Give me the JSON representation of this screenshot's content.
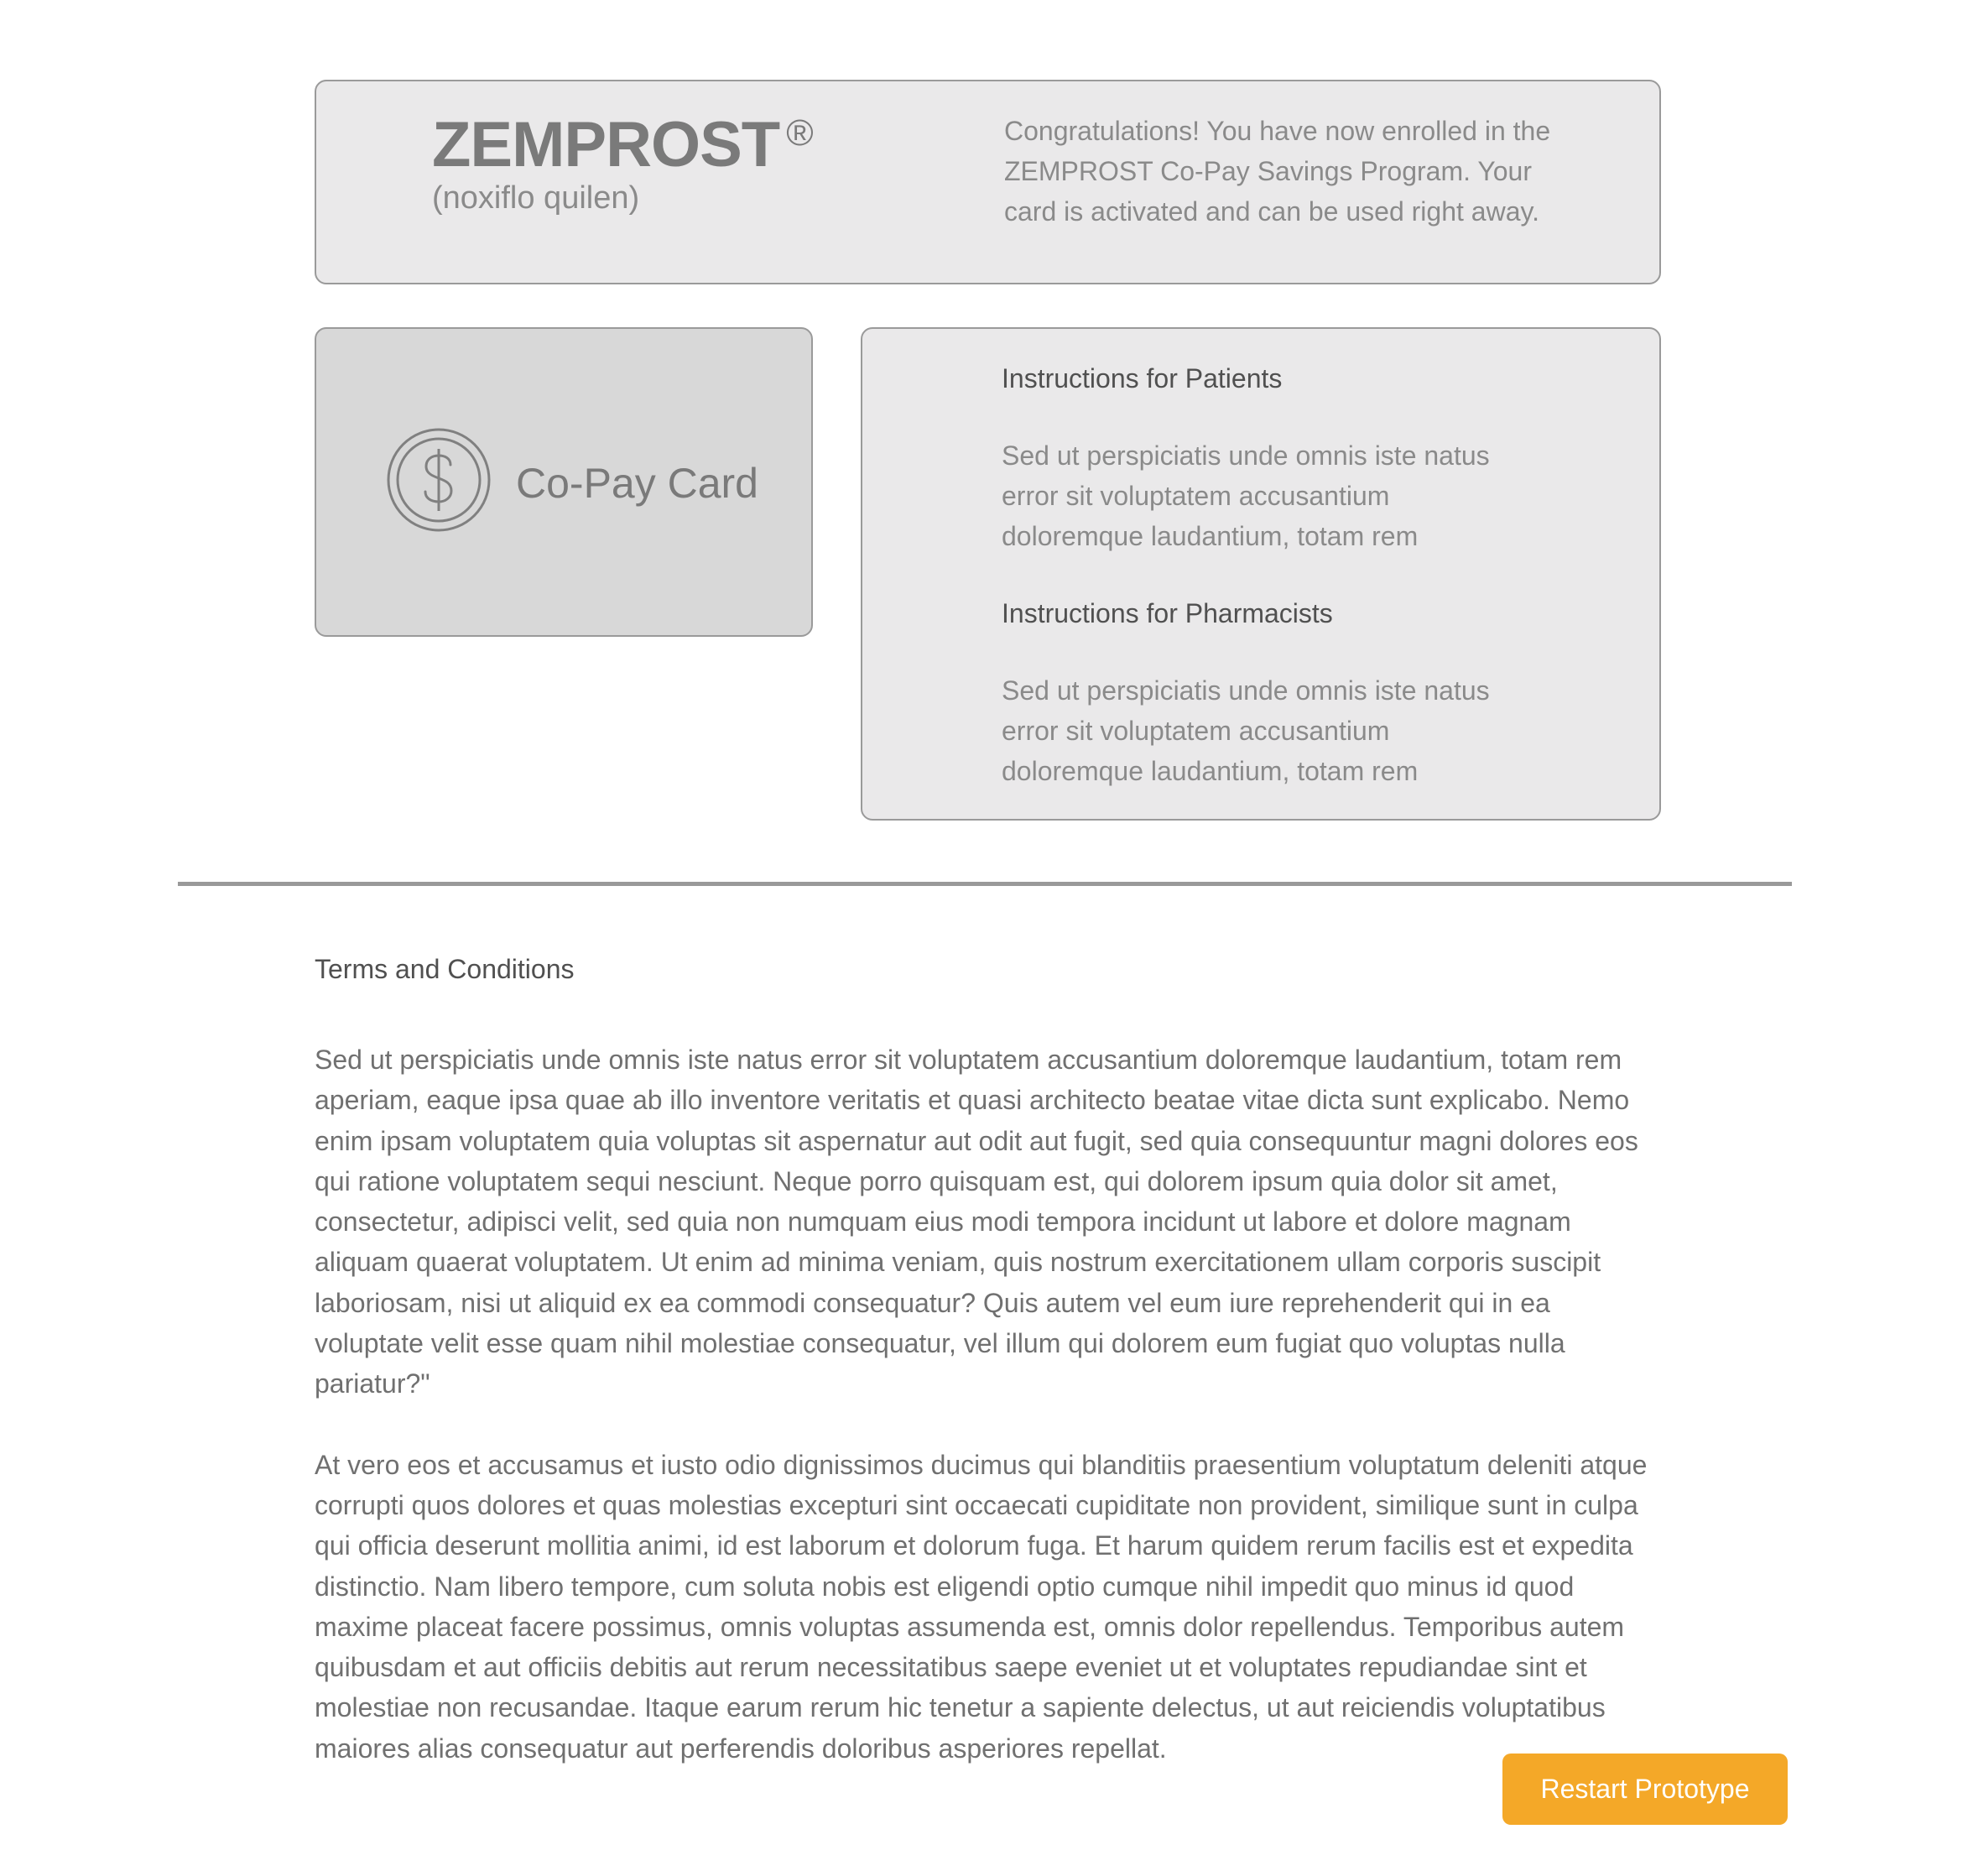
{
  "header": {
    "brand_name": "ZEMPROST",
    "brand_reg": "®",
    "brand_generic": "(noxiflo quilen)",
    "message": "Congratulations! You have now enrolled in the ZEMPROST Co-Pay Savings Program. Your card is activated and can be used right away."
  },
  "card": {
    "icon": "dollar-coin-icon",
    "label": "Co-Pay Card"
  },
  "instructions": {
    "patients_title": "Instructions for Patients",
    "patients_text": "Sed ut perspiciatis unde omnis iste natus error sit voluptatem accusantium doloremque laudantium, totam rem",
    "pharmacists_title": "Instructions for Pharmacists",
    "pharmacists_text": "Sed ut perspiciatis unde omnis iste natus error sit voluptatem accusantium doloremque laudantium, totam rem"
  },
  "terms": {
    "title": "Terms and Conditions",
    "paragraphs": [
      "Sed ut perspiciatis unde omnis iste natus error sit voluptatem accusantium doloremque laudantium, totam rem aperiam, eaque ipsa quae ab illo inventore veritatis et quasi architecto beatae vitae dicta sunt explicabo. Nemo enim ipsam voluptatem quia voluptas sit aspernatur aut odit aut fugit, sed quia consequuntur magni dolores eos qui ratione voluptatem sequi nesciunt. Neque porro quisquam est, qui dolorem ipsum quia dolor sit amet, consectetur, adipisci velit, sed quia non numquam eius modi tempora incidunt ut labore et dolore magnam aliquam quaerat voluptatem. Ut enim ad minima veniam, quis nostrum exercitationem ullam corporis suscipit laboriosam, nisi ut aliquid ex ea commodi consequatur? Quis autem vel eum iure reprehenderit qui in ea voluptate velit esse quam nihil molestiae consequatur, vel illum qui dolorem eum fugiat quo voluptas nulla pariatur?\"",
      "At vero eos et accusamus et iusto odio dignissimos ducimus qui blanditiis praesentium voluptatum deleniti atque corrupti quos dolores et quas molestias excepturi sint occaecati cupiditate non provident, similique sunt in culpa qui officia deserunt mollitia animi, id est laborum et dolorum fuga. Et harum quidem rerum facilis est et expedita distinctio. Nam libero tempore, cum soluta nobis est eligendi optio cumque nihil impedit quo minus id quod maxime placeat facere possimus, omnis voluptas assumenda est, omnis dolor repellendus. Temporibus autem quibusdam et aut officiis debitis aut rerum necessitatibus saepe eveniet ut et voluptates repudiandae sint et molestiae non recusandae. Itaque earum rerum hic tenetur a sapiente delectus, ut aut reiciendis voluptatibus maiores alias consequatur aut perferendis doloribus asperiores repellat."
    ]
  },
  "actions": {
    "restart_label": "Restart Prototype"
  },
  "colors": {
    "accent": "#f4a828",
    "box_bg": "#eae9ea",
    "card_bg": "#d8d8d8",
    "border": "#9a9a9a"
  }
}
